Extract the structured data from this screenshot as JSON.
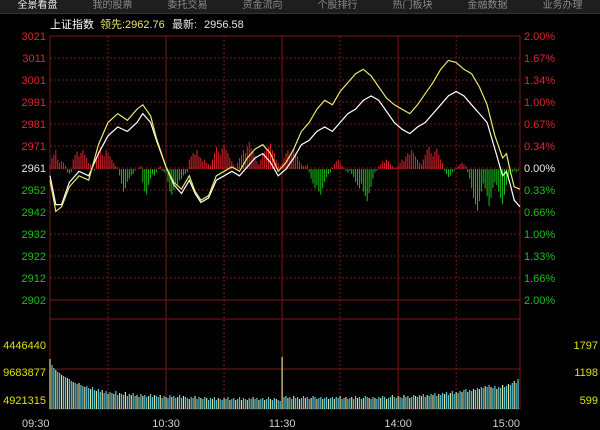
{
  "tabs": [
    "全景看盘",
    "我的股票",
    "委托交易",
    "资金流向",
    "个股排行",
    "热门板块",
    "金融数据",
    "业务办理"
  ],
  "header": {
    "index_name": "上证指数",
    "leader_label": "领先:",
    "leader_value": "2962.76",
    "latest_label": "最新:",
    "latest_value": "2956.58"
  },
  "colors": {
    "up": "#e0242c",
    "down": "#18c018",
    "flat": "#e6e6e6",
    "price_line": "#ffffff",
    "leader_line": "#e8e870",
    "grid": "#7a1a1a",
    "volume_bar_a": "#5bc8d8",
    "volume_bar_b": "#e8d890"
  },
  "chart_data": {
    "type": "line",
    "base_price": 2961,
    "price_ticks": [
      "3021",
      "3011",
      "3001",
      "2991",
      "2981",
      "2971",
      "2961",
      "2952",
      "2942",
      "2932",
      "2922",
      "2912",
      "2902"
    ],
    "pct_ticks": [
      "2.00%",
      "1.67%",
      "1.34%",
      "1.00%",
      "0.67%",
      "0.34%",
      "0.00%",
      "0.33%",
      "0.66%",
      "1.00%",
      "1.33%",
      "1.66%",
      "2.00%"
    ],
    "ylim": [
      2902,
      3021
    ],
    "time_labels": [
      "09:30",
      "10:30",
      "11:30",
      "14:00",
      "15:00"
    ],
    "volume_ticks_left": [
      "4446440",
      "9683877",
      "4921315"
    ],
    "volume_ticks_right": [
      "1797",
      "1198",
      "599"
    ],
    "series": [
      {
        "name": "最新",
        "values": [
          [
            0,
            2958
          ],
          [
            3,
            2945
          ],
          [
            6,
            2945
          ],
          [
            10,
            2955
          ],
          [
            15,
            2960
          ],
          [
            20,
            2958
          ],
          [
            25,
            2968
          ],
          [
            30,
            2976
          ],
          [
            35,
            2980
          ],
          [
            40,
            2978
          ],
          [
            45,
            2982
          ],
          [
            48,
            2986
          ],
          [
            52,
            2982
          ],
          [
            55,
            2974
          ],
          [
            60,
            2962
          ],
          [
            64,
            2954
          ],
          [
            68,
            2950
          ],
          [
            72,
            2956
          ],
          [
            75,
            2950
          ],
          [
            78,
            2946
          ],
          [
            82,
            2948
          ],
          [
            86,
            2956
          ],
          [
            90,
            2958
          ],
          [
            94,
            2960
          ],
          [
            98,
            2958
          ],
          [
            102,
            2962
          ],
          [
            106,
            2966
          ],
          [
            110,
            2968
          ],
          [
            114,
            2964
          ],
          [
            118,
            2958
          ],
          [
            122,
            2961
          ],
          [
            126,
            2966
          ],
          [
            130,
            2972
          ],
          [
            134,
            2974
          ],
          [
            138,
            2978
          ],
          [
            142,
            2980
          ],
          [
            146,
            2978
          ],
          [
            150,
            2982
          ],
          [
            154,
            2986
          ],
          [
            158,
            2988
          ],
          [
            162,
            2992
          ],
          [
            166,
            2994
          ],
          [
            170,
            2992
          ],
          [
            174,
            2987
          ],
          [
            178,
            2982
          ],
          [
            182,
            2979
          ],
          [
            186,
            2977
          ],
          [
            190,
            2980
          ],
          [
            194,
            2982
          ],
          [
            198,
            2986
          ],
          [
            202,
            2990
          ],
          [
            206,
            2994
          ],
          [
            210,
            2996
          ],
          [
            214,
            2994
          ],
          [
            218,
            2990
          ],
          [
            222,
            2986
          ],
          [
            226,
            2982
          ],
          [
            230,
            2970
          ],
          [
            234,
            2958
          ],
          [
            236,
            2960
          ],
          [
            238,
            2954
          ],
          [
            240,
            2947
          ],
          [
            243,
            2944
          ]
        ]
      },
      {
        "name": "领先",
        "values": [
          [
            0,
            2956
          ],
          [
            3,
            2942
          ],
          [
            6,
            2944
          ],
          [
            10,
            2953
          ],
          [
            15,
            2958
          ],
          [
            20,
            2956
          ],
          [
            25,
            2972
          ],
          [
            30,
            2982
          ],
          [
            35,
            2986
          ],
          [
            40,
            2983
          ],
          [
            45,
            2988
          ],
          [
            48,
            2990
          ],
          [
            52,
            2985
          ],
          [
            55,
            2975
          ],
          [
            60,
            2962
          ],
          [
            64,
            2955
          ],
          [
            68,
            2952
          ],
          [
            72,
            2958
          ],
          [
            75,
            2951
          ],
          [
            78,
            2947
          ],
          [
            82,
            2949
          ],
          [
            86,
            2958
          ],
          [
            90,
            2960
          ],
          [
            94,
            2962
          ],
          [
            98,
            2960
          ],
          [
            102,
            2966
          ],
          [
            106,
            2970
          ],
          [
            110,
            2972
          ],
          [
            114,
            2968
          ],
          [
            118,
            2960
          ],
          [
            122,
            2964
          ],
          [
            126,
            2970
          ],
          [
            130,
            2978
          ],
          [
            134,
            2982
          ],
          [
            138,
            2988
          ],
          [
            142,
            2992
          ],
          [
            146,
            2990
          ],
          [
            150,
            2996
          ],
          [
            154,
            3000
          ],
          [
            158,
            3004
          ],
          [
            162,
            3006
          ],
          [
            166,
            3003
          ],
          [
            170,
            2998
          ],
          [
            174,
            2993
          ],
          [
            178,
            2990
          ],
          [
            182,
            2988
          ],
          [
            186,
            2986
          ],
          [
            190,
            2990
          ],
          [
            194,
            2995
          ],
          [
            198,
            3000
          ],
          [
            202,
            3006
          ],
          [
            206,
            3010
          ],
          [
            210,
            3009
          ],
          [
            214,
            3006
          ],
          [
            218,
            3004
          ],
          [
            222,
            2998
          ],
          [
            226,
            2990
          ],
          [
            230,
            2976
          ],
          [
            234,
            2966
          ],
          [
            236,
            2968
          ],
          [
            238,
            2960
          ],
          [
            240,
            2953
          ],
          [
            243,
            2952
          ]
        ]
      }
    ],
    "advance_decline": [
      3,
      7,
      9,
      12,
      6,
      4,
      5,
      4,
      2,
      -2,
      -3,
      -2,
      6,
      9,
      11,
      8,
      10,
      12,
      9,
      7,
      4,
      3,
      1,
      -1,
      7,
      11,
      14,
      9,
      8,
      12,
      10,
      8,
      6,
      4,
      2,
      1,
      -4,
      -9,
      -14,
      -12,
      -8,
      -6,
      -4,
      -3,
      -1,
      0,
      1,
      2,
      -8,
      -14,
      -16,
      -10,
      -6,
      -3,
      -4,
      -2,
      1,
      2,
      -1,
      -2,
      -2,
      -8,
      -14,
      -16,
      -13,
      -9,
      -10,
      -7,
      -6,
      -4,
      -3,
      -2,
      6,
      8,
      10,
      9,
      12,
      8,
      7,
      5,
      6,
      4,
      3,
      2,
      6,
      10,
      14,
      11,
      9,
      13,
      15,
      12,
      10,
      7,
      5,
      3,
      1,
      4,
      7,
      9,
      12,
      10,
      14,
      17,
      13,
      11,
      8,
      5,
      3,
      6,
      9,
      11,
      12,
      14,
      16,
      12,
      10,
      6,
      4,
      2,
      4,
      7,
      10,
      12,
      9,
      11,
      13,
      10,
      8,
      5,
      3,
      2,
      2,
      3,
      -2,
      -6,
      -9,
      -12,
      -10,
      -14,
      -16,
      -12,
      -8,
      -5,
      -3,
      -2,
      1,
      3,
      5,
      6,
      4,
      2,
      1,
      -1,
      -2,
      -1,
      -3,
      -5,
      -8,
      -10,
      -12,
      -9,
      -14,
      -17,
      -20,
      -15,
      -11,
      -6,
      -2,
      -1,
      2,
      3,
      5,
      4,
      6,
      5,
      3,
      2,
      1,
      1,
      2,
      4,
      6,
      5,
      8,
      10,
      9,
      12,
      10,
      8,
      6,
      4,
      3,
      6,
      9,
      12,
      14,
      10,
      8,
      11,
      13,
      9,
      6,
      4,
      -1,
      -3,
      -5,
      -4,
      -2,
      -1,
      1,
      2,
      3,
      4,
      3,
      2,
      -2,
      -6,
      -12,
      -18,
      -22,
      -26,
      -20,
      -14,
      -9,
      -12,
      -17,
      -23,
      -18,
      -12,
      -8,
      -10,
      -14,
      -18,
      -22,
      -16,
      -10,
      -6,
      -3,
      -2,
      -1,
      -2,
      -1
    ],
    "volume": [
      50,
      44,
      41,
      39,
      37,
      36,
      34,
      33,
      32,
      31,
      30,
      28,
      27,
      26,
      25,
      26,
      24,
      23,
      22,
      23,
      21,
      20,
      22,
      19,
      18,
      20,
      17,
      19,
      16,
      18,
      15,
      17,
      16,
      15,
      18,
      14,
      16,
      15,
      14,
      17,
      13,
      15,
      14,
      16,
      13,
      14,
      12,
      15,
      13,
      14,
      12,
      13,
      15,
      12,
      14,
      13,
      12,
      14,
      11,
      13,
      12,
      11,
      14,
      12,
      13,
      11,
      12,
      14,
      11,
      13,
      12,
      11,
      10,
      12,
      11,
      13,
      10,
      12,
      11,
      10,
      12,
      11,
      9,
      11,
      10,
      12,
      9,
      11,
      10,
      9,
      11,
      10,
      12,
      9,
      10,
      11,
      9,
      10,
      12,
      9,
      11,
      10,
      9,
      11,
      10,
      12,
      10,
      11,
      9,
      10,
      11,
      9,
      10,
      12,
      10,
      9,
      11,
      10,
      9,
      8,
      52,
      12,
      13,
      11,
      12,
      10,
      13,
      11,
      12,
      10,
      11,
      13,
      11,
      12,
      10,
      11,
      13,
      12,
      10,
      11,
      12,
      10,
      11,
      12,
      10,
      11,
      12,
      10,
      12,
      11,
      13,
      10,
      11,
      12,
      10,
      11,
      12,
      10,
      13,
      11,
      12,
      10,
      11,
      13,
      12,
      11,
      10,
      12,
      11,
      10,
      12,
      11,
      13,
      12,
      10,
      11,
      12,
      14,
      12,
      11,
      13,
      12,
      11,
      14,
      12,
      13,
      11,
      12,
      14,
      13,
      12,
      14,
      13,
      15,
      12,
      14,
      13,
      15,
      14,
      16,
      13,
      15,
      14,
      16,
      15,
      17,
      14,
      16,
      18,
      15,
      17,
      16,
      18,
      17,
      19,
      20,
      17,
      19,
      18,
      20,
      19,
      21,
      20,
      22,
      21,
      23,
      22,
      24,
      22,
      21,
      23,
      20,
      22,
      21,
      24,
      22,
      23,
      25,
      24,
      26,
      28,
      26,
      30
    ]
  }
}
